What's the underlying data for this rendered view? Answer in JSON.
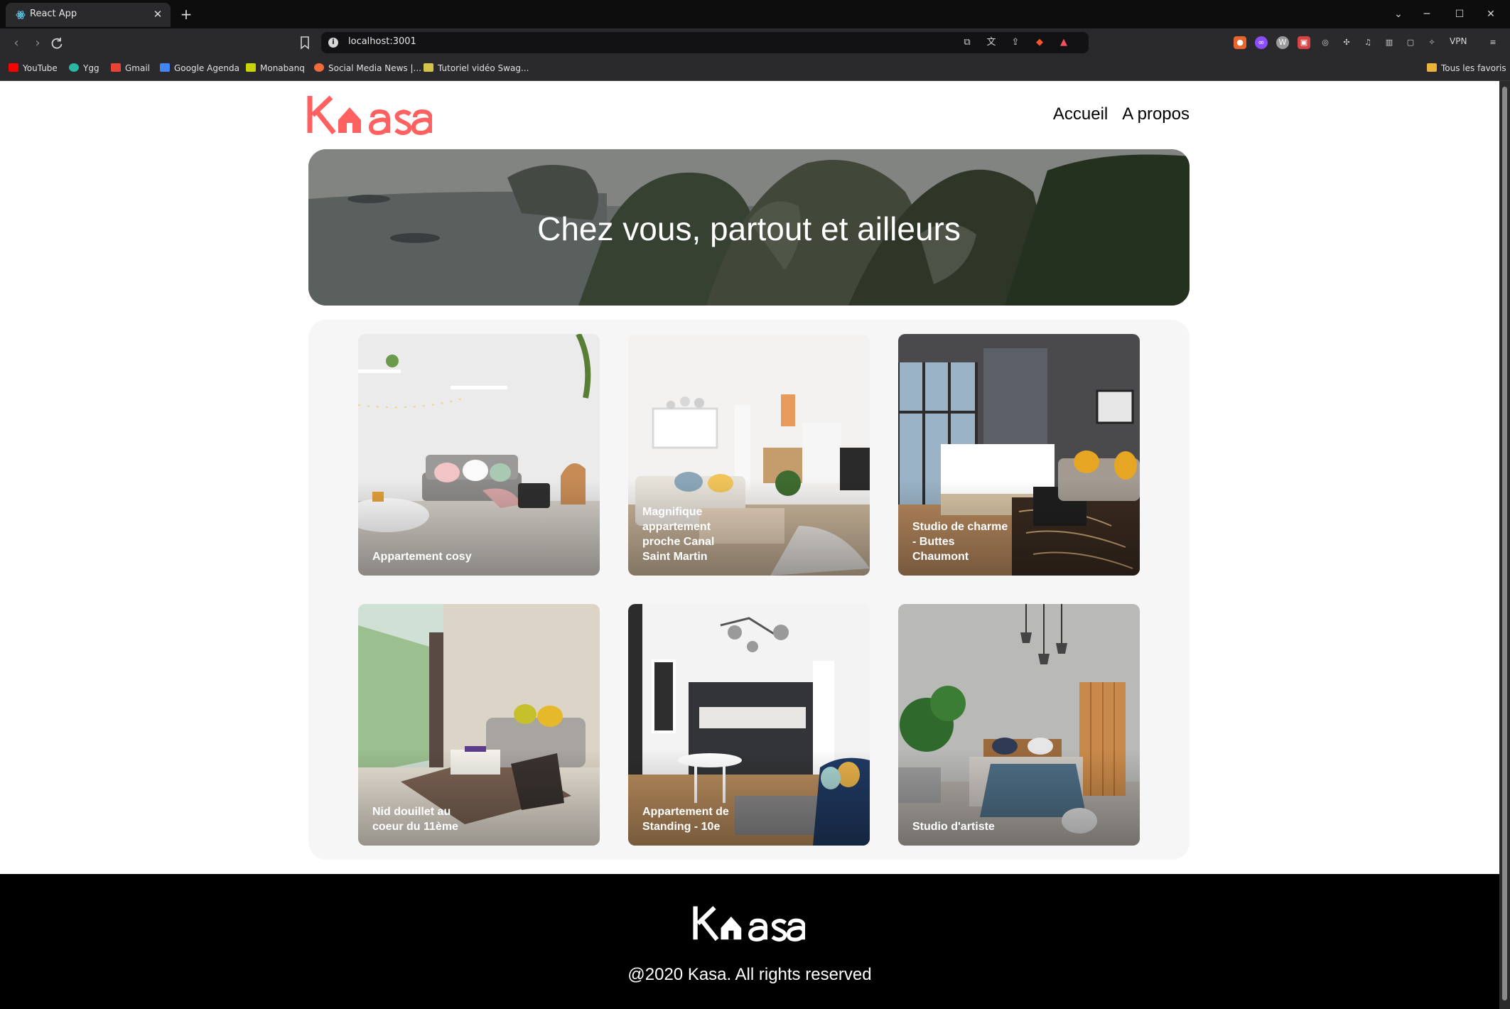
{
  "browser": {
    "tab_title": "React App",
    "tab_close": "✕",
    "new_tab": "+",
    "url": "localhost:3001",
    "vpn_label": "VPN",
    "window_controls": [
      "⌄",
      "─",
      "☐",
      "✕"
    ],
    "bookmarks": [
      {
        "label": "YouTube",
        "icon": "youtube-icon",
        "color": "#ff0000"
      },
      {
        "label": "Ygg",
        "icon": "ygg-icon",
        "color": "#2bb7a3"
      },
      {
        "label": "Gmail",
        "icon": "gmail-icon",
        "color": "#ea4335"
      },
      {
        "label": "Google Agenda",
        "icon": "calendar-icon",
        "color": "#4285f4"
      },
      {
        "label": "Monabanq",
        "icon": "monabanq-icon",
        "color": "#c8d400"
      },
      {
        "label": "Social Media News |...",
        "icon": "news-icon",
        "color": "#f26b3a"
      },
      {
        "label": "Tutoriel vidéo Swag...",
        "icon": "tutorial-icon",
        "color": "#d4c24a"
      }
    ],
    "all_bookmarks_label": "Tous les favoris"
  },
  "site": {
    "logo_text": "Kasa",
    "brand_color": "#ff6060",
    "nav": [
      {
        "label": "Accueil"
      },
      {
        "label": "A propos"
      }
    ],
    "banner_title": "Chez vous, partout et ailleurs",
    "cards": [
      {
        "title": "Appartement cosy",
        "scene": "living-room-light"
      },
      {
        "title": "Magnifique appartement proche Canal Saint Martin",
        "scene": "living-room-bright"
      },
      {
        "title": "Studio de charme - Buttes Chaumont",
        "scene": "bedroom-city"
      },
      {
        "title": "Nid douillet au coeur du 11ème",
        "scene": "living-room-window"
      },
      {
        "title": "Appartement de Standing - 10e",
        "scene": "kitchen-dining"
      },
      {
        "title": "Studio d'artiste",
        "scene": "bedroom-concrete"
      }
    ],
    "footer_text": "@2020 Kasa. All rights reserved"
  }
}
